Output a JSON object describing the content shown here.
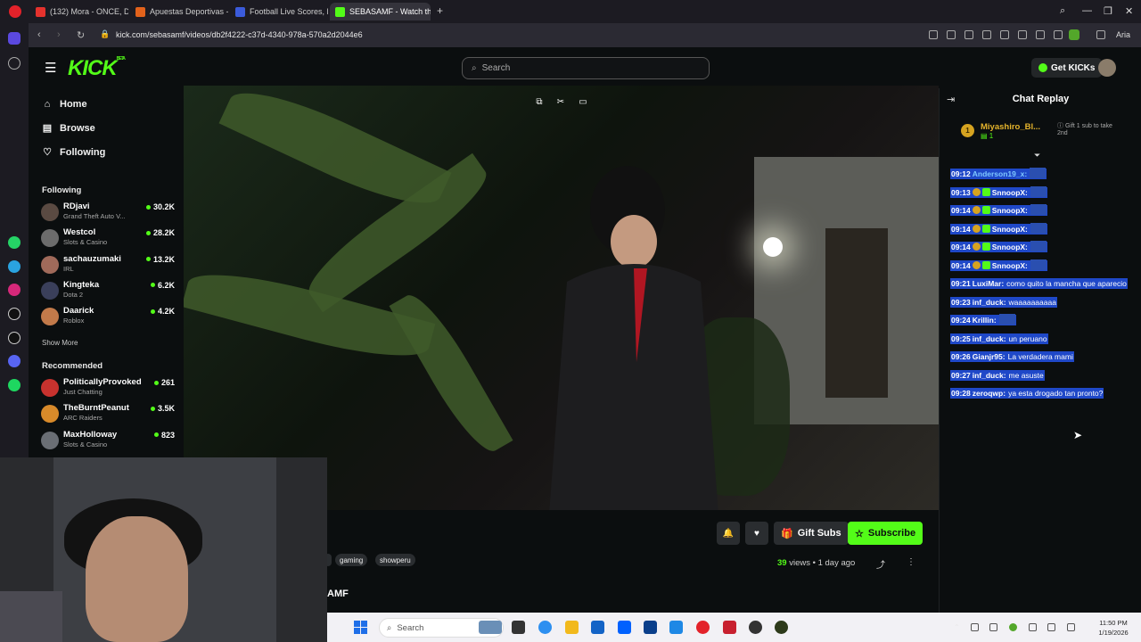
{
  "browser": {
    "tabs": [
      {
        "title": "(132) Mora - ONCE, D",
        "color": "#e5322d",
        "active": false
      },
      {
        "title": "Apuestas Deportivas - Ca",
        "color": "#e2621b",
        "active": false
      },
      {
        "title": "Football Live Scores, Fixtu",
        "color": "#3b5bdb",
        "active": false
      },
      {
        "title": "SEBASAMF - Watch th",
        "color": "#53fc18",
        "active": true
      }
    ],
    "url": "kick.com/sebasamf/videos/db2f4222-c37d-4340-978a-570a2d2044e6",
    "ai_label": "Aria"
  },
  "header": {
    "logo": "KICK",
    "logo_badge": "BETA",
    "search_placeholder": "Search",
    "get_kicks": "Get KICKs"
  },
  "sidebar": {
    "nav": [
      {
        "label": "Home",
        "icon": "home-icon"
      },
      {
        "label": "Browse",
        "icon": "browse-icon"
      },
      {
        "label": "Following",
        "icon": "heart-icon"
      }
    ],
    "following_heading": "Following",
    "following": [
      {
        "name": "RDjavi",
        "category": "Grand Theft Auto V...",
        "viewers": "30.2K",
        "color": "#5a4a42"
      },
      {
        "name": "Westcol",
        "category": "Slots & Casino",
        "viewers": "28.2K",
        "color": "#6c6c6c"
      },
      {
        "name": "sachauzumaki",
        "category": "IRL",
        "viewers": "13.2K",
        "color": "#a06a5a"
      },
      {
        "name": "Kingteka",
        "category": "Dota 2",
        "viewers": "6.2K",
        "color": "#3a3f5a"
      },
      {
        "name": "Daarick",
        "category": "Roblox",
        "viewers": "4.2K",
        "color": "#c27a4a"
      }
    ],
    "show_more": "Show More",
    "recommended_heading": "Recommended",
    "recommended": [
      {
        "name": "PoliticallyProvoked",
        "category": "Just Chatting",
        "viewers": "261",
        "color": "#c8322e"
      },
      {
        "name": "TheBurntPeanut",
        "category": "ARC Raiders",
        "viewers": "3.5K",
        "color": "#d88a2a"
      },
      {
        "name": "MaxHolloway",
        "category": "Slots & Casino",
        "viewers": "823",
        "color": "#6a6e74"
      }
    ]
  },
  "video": {
    "gift_subs": "Gift Subs",
    "subscribe": "Subscribe",
    "tags": [
      "gaming",
      "showperu"
    ],
    "views_count": "39",
    "views_label": "views",
    "separator": "•",
    "age": "1 day ago",
    "channel_name_fragment": "AMF"
  },
  "chat": {
    "title": "Chat Replay",
    "pinned": {
      "rank": "1",
      "name": "Miyashiro_Bl...",
      "sub_count": "1",
      "gift_text": "Gift 1 sub to take 2nd"
    },
    "messages": [
      {
        "time": "09:12",
        "user": "Anderson19_x:",
        "text": "",
        "user_color": "#7ec8ff",
        "emote": true
      },
      {
        "time": "09:13",
        "user": "SnnoopX:",
        "text": "",
        "user_color": "#ffffff",
        "emote": true
      },
      {
        "time": "09:14",
        "user": "SnnoopX:",
        "text": "",
        "user_color": "#ffffff",
        "emote": true
      },
      {
        "time": "09:14",
        "user": "SnnoopX:",
        "text": "",
        "user_color": "#ffffff",
        "emote": true
      },
      {
        "time": "09:14",
        "user": "SnnoopX:",
        "text": "",
        "user_color": "#ffffff",
        "emote": true
      },
      {
        "time": "09:14",
        "user": "SnnoopX:",
        "text": "",
        "user_color": "#ffffff",
        "emote": true
      },
      {
        "time": "09:21",
        "user": "LuxiMar:",
        "text": "como quito la mancha que aparecio",
        "user_color": "#ffffff",
        "emote": false
      },
      {
        "time": "09:23",
        "user": "inf_duck:",
        "text": "waaaaaaaaaa",
        "user_color": "#ffffff",
        "emote": false
      },
      {
        "time": "09:24",
        "user": "Krillin:",
        "text": "",
        "user_color": "#ffffff",
        "emote": true
      },
      {
        "time": "09:25",
        "user": "inf_duck:",
        "text": "un peruano",
        "user_color": "#ffffff",
        "emote": false
      },
      {
        "time": "09:26",
        "user": "Gianjr95:",
        "text": "La verdadera mami",
        "user_color": "#ffffff",
        "emote": false
      },
      {
        "time": "09:27",
        "user": "inf_duck:",
        "text": "me asuste",
        "user_color": "#ffffff",
        "emote": false
      },
      {
        "time": "09:28",
        "user": "zeroqwp:",
        "text": "ya esta drogado tan pronto?",
        "user_color": "#ffffff",
        "emote": false
      }
    ]
  },
  "taskbar": {
    "search_placeholder": "Search",
    "time": "11:50 PM",
    "date": "1/19/2026"
  },
  "colors": {
    "accent": "#53fc18",
    "background": "#0b0e0f",
    "chat_highlight": "#1f48c8"
  }
}
